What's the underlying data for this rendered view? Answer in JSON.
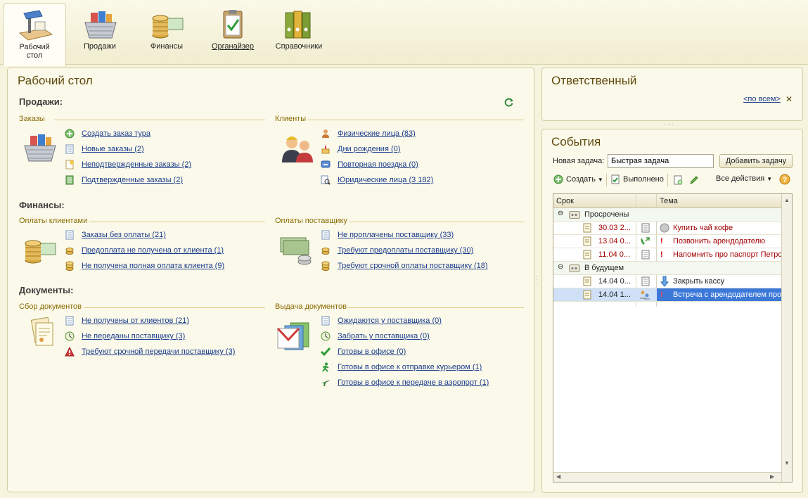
{
  "sections": [
    {
      "label": "Рабочий\nстол"
    },
    {
      "label": "Продажи"
    },
    {
      "label": "Финансы"
    },
    {
      "label": "Органайзер"
    },
    {
      "label": "Справочники"
    }
  ],
  "desktop": {
    "title": "Рабочий стол",
    "sales": {
      "title": "Продажи:",
      "orders_title": "Заказы",
      "orders": [
        "Создать заказ тура",
        "Новые заказы (2)",
        "Неподтвержденные заказы (2)",
        "Подтвержденные заказы (2)"
      ],
      "clients_title": "Клиенты",
      "clients": [
        "Физические лица (83)",
        "Дни рождения (0)",
        "Повторная поездка (0)",
        "Юридические лица (3 182)"
      ]
    },
    "finance": {
      "title": "Финансы:",
      "client_pay_title": "Оплаты клиентами",
      "client_pay": [
        "Заказы без оплаты (21)",
        "Предоплата не получена от клиента (1)",
        "Не получена полная оплата клиента (9)"
      ],
      "supplier_pay_title": "Оплаты поставщику",
      "supplier_pay": [
        "Не проплачены поставщику (33)",
        "Требуют предоплаты поставщику (30)",
        "Требуют срочной оплаты поставщику (18)"
      ]
    },
    "docs": {
      "title": "Документы:",
      "collect_title": "Сбор документов",
      "collect": [
        "Не получены от клиентов (21)",
        "Не переданы поставщику (3)",
        "Требуют срочной передачи поставщику (3)"
      ],
      "issue_title": "Выдача документов",
      "issue": [
        "Ожидаются у поставщика (0)",
        "Забрать у поставщика (0)",
        "Готовы в офисе (0)",
        "Готовы в офисе к отправке курьером (1)",
        "Готовы в офисе к передаче в аэропорт (1)"
      ]
    }
  },
  "responsible": {
    "title": "Ответственный",
    "filter_link": "<по всем>",
    "clear": "✕"
  },
  "events": {
    "title": "События",
    "new_task_label": "Новая задача:",
    "new_task_value": "Быстрая задача",
    "add_task_button": "Добавить задачу",
    "create_button": "Создать",
    "done_button": "Выполнено",
    "all_actions": "Все действия",
    "col_date": "Срок",
    "col_subject": "Тема",
    "groups": [
      {
        "name": "Просрочены",
        "rows": [
          {
            "date": "30.03 2...",
            "subject": "Купить чай кофе"
          },
          {
            "date": "13.04 0...",
            "subject": "Позвонить арендодателю"
          },
          {
            "date": "11.04 0...",
            "subject": "Напомнить про паспорт Петро"
          }
        ]
      },
      {
        "name": "В будущем",
        "rows": [
          {
            "date": "14.04 0...",
            "subject": "Закрыть кассу"
          },
          {
            "date": "14.04 1...",
            "subject": "Встреча с арендодателем про"
          }
        ]
      }
    ]
  },
  "colors": {
    "accent": "#5f4a0c",
    "link": "#1a3c8c",
    "overdue": "#a20000",
    "selected": "#cfe0f7"
  }
}
